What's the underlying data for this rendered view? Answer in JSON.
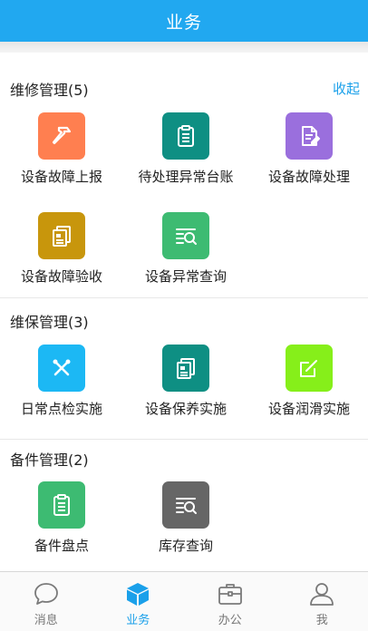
{
  "header": {
    "title": "业务"
  },
  "sections": [
    {
      "title": "维修管理(5)",
      "action": "收起",
      "items": [
        {
          "label": "设备故障上报",
          "icon": "hammer-icon",
          "color": "#ff7f50"
        },
        {
          "label": "待处理异常台账",
          "icon": "clipboard-icon",
          "color": "#0e8f83"
        },
        {
          "label": "设备故障处理",
          "icon": "document-edit-icon",
          "color": "#9a6fdd"
        },
        {
          "label": "设备故障验收",
          "icon": "files-icon",
          "color": "#c8960c"
        },
        {
          "label": "设备异常查询",
          "icon": "search-list-icon",
          "color": "#3dbb72"
        }
      ]
    },
    {
      "title": "维保管理(3)",
      "items": [
        {
          "label": "日常点检实施",
          "icon": "tools-icon",
          "color": "#1cb8f4"
        },
        {
          "label": "设备保养实施",
          "icon": "files-icon",
          "color": "#0e8f83"
        },
        {
          "label": "设备润滑实施",
          "icon": "edit-square-icon",
          "color": "#86ef1a"
        }
      ]
    },
    {
      "title": "备件管理(2)",
      "items": [
        {
          "label": "备件盘点",
          "icon": "clipboard-icon",
          "color": "#3dbb72"
        },
        {
          "label": "库存查询",
          "icon": "search-list-icon",
          "color": "#666666"
        }
      ]
    }
  ],
  "tabbar": {
    "items": [
      {
        "label": "消息",
        "icon": "chat-bubble-icon"
      },
      {
        "label": "业务",
        "icon": "cube-icon",
        "active": true
      },
      {
        "label": "办公",
        "icon": "briefcase-icon"
      },
      {
        "label": "我",
        "icon": "user-icon"
      }
    ],
    "active_color": "#1aa0ea"
  }
}
